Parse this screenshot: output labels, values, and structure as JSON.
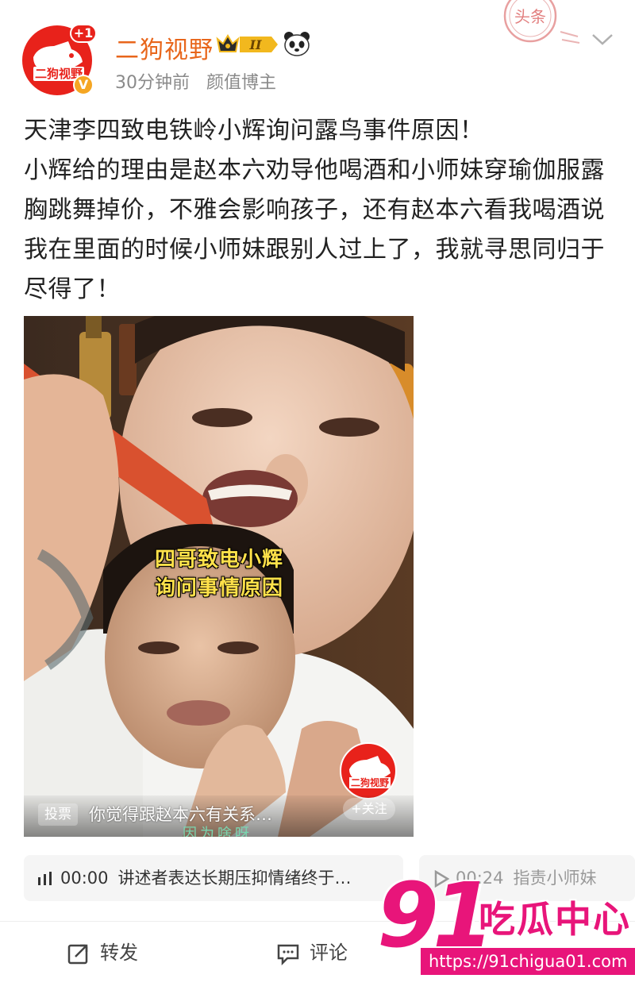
{
  "header": {
    "username": "二狗视野",
    "avatar_badge": "+1",
    "avatar_text": "二狗视野",
    "rank_label": "II",
    "time": "30分钟前",
    "role": "颜值博主",
    "stamp_text": "头条"
  },
  "post": {
    "lines": [
      "天津李四致电铁岭小辉询问露鸟事件原因！",
      "小辉给的理由是赵本六劝导他喝酒和小师妹穿瑜伽服露胸跳舞掉价，不雅会影响孩子，还有赵本六看我喝酒说我在里面的时候小师妹跟别人过上了，我就寻思同归于尽得了！"
    ]
  },
  "video": {
    "caption_line1": "四哥致电小辉",
    "caption_line2": "询问事情原因",
    "poll_tag": "投票",
    "poll_text": "你觉得跟赵本六有关系…",
    "logo_text": "二狗视野",
    "follow_label": "+关注",
    "bottom_text": "因为啥呀"
  },
  "audio": [
    {
      "time": "00:00",
      "text": "讲述者表达长期压抑情绪终于…"
    },
    {
      "time": "00:24",
      "text": "指责小师妹"
    }
  ],
  "actions": {
    "repost": "转发",
    "comment": "评论"
  },
  "watermark": {
    "number": "91",
    "name": "吃瓜中心",
    "url": "https://91chigua01.com"
  },
  "colors": {
    "brand_red": "#e8221b",
    "username_orange": "#e8661b",
    "watermark_pink": "#e8157a",
    "caption_yellow": "#ffe14a"
  }
}
